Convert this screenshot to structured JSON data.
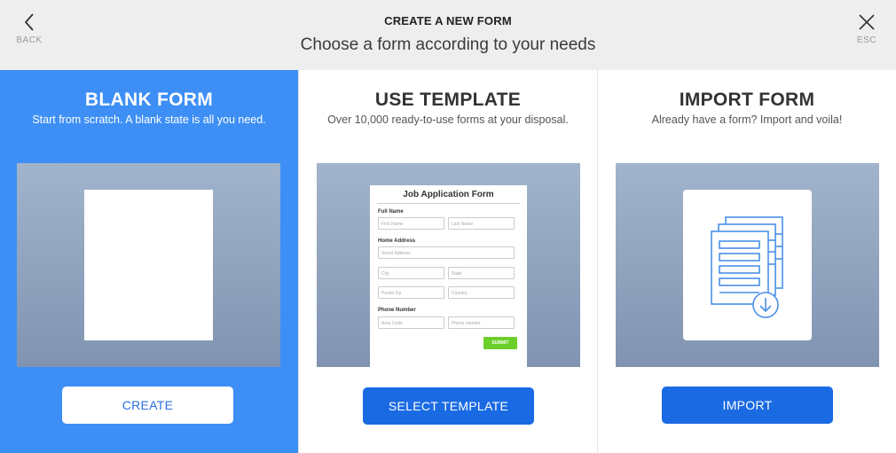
{
  "header": {
    "back_label": "BACK",
    "esc_label": "ESC",
    "title": "CREATE A NEW FORM",
    "subtitle": "Choose a form according to your needs"
  },
  "panels": {
    "blank": {
      "title": "BLANK FORM",
      "description": "Start from scratch. A blank state is all you need.",
      "button": "CREATE"
    },
    "template": {
      "title": "USE TEMPLATE",
      "description": "Over 10,000 ready-to-use forms at your disposal.",
      "button": "SELECT TEMPLATE",
      "preview": {
        "form_title": "Job Application Form",
        "full_name_label": "Full Name",
        "first_name": "First Name",
        "last_name": "Last Name",
        "home_address_label": "Home Address",
        "street_address": "Street Address",
        "city": "City",
        "state": "State",
        "postal_zip": "Postal Zip",
        "country": "Country",
        "phone_label": "Phone Number",
        "area_code": "Area Code",
        "phone_number": "Phone number",
        "submit": "SUBMIT"
      }
    },
    "import": {
      "title": "IMPORT FORM",
      "description": "Already have a form? Import and voila!",
      "button": "IMPORT"
    }
  },
  "colors": {
    "accent_blue": "#3d8ff5",
    "button_blue": "#1a6ae4",
    "submit_green": "#6cce2a"
  },
  "icons": {
    "back": "chevron-left-icon",
    "esc": "close-icon",
    "import": "document-download-icon"
  }
}
